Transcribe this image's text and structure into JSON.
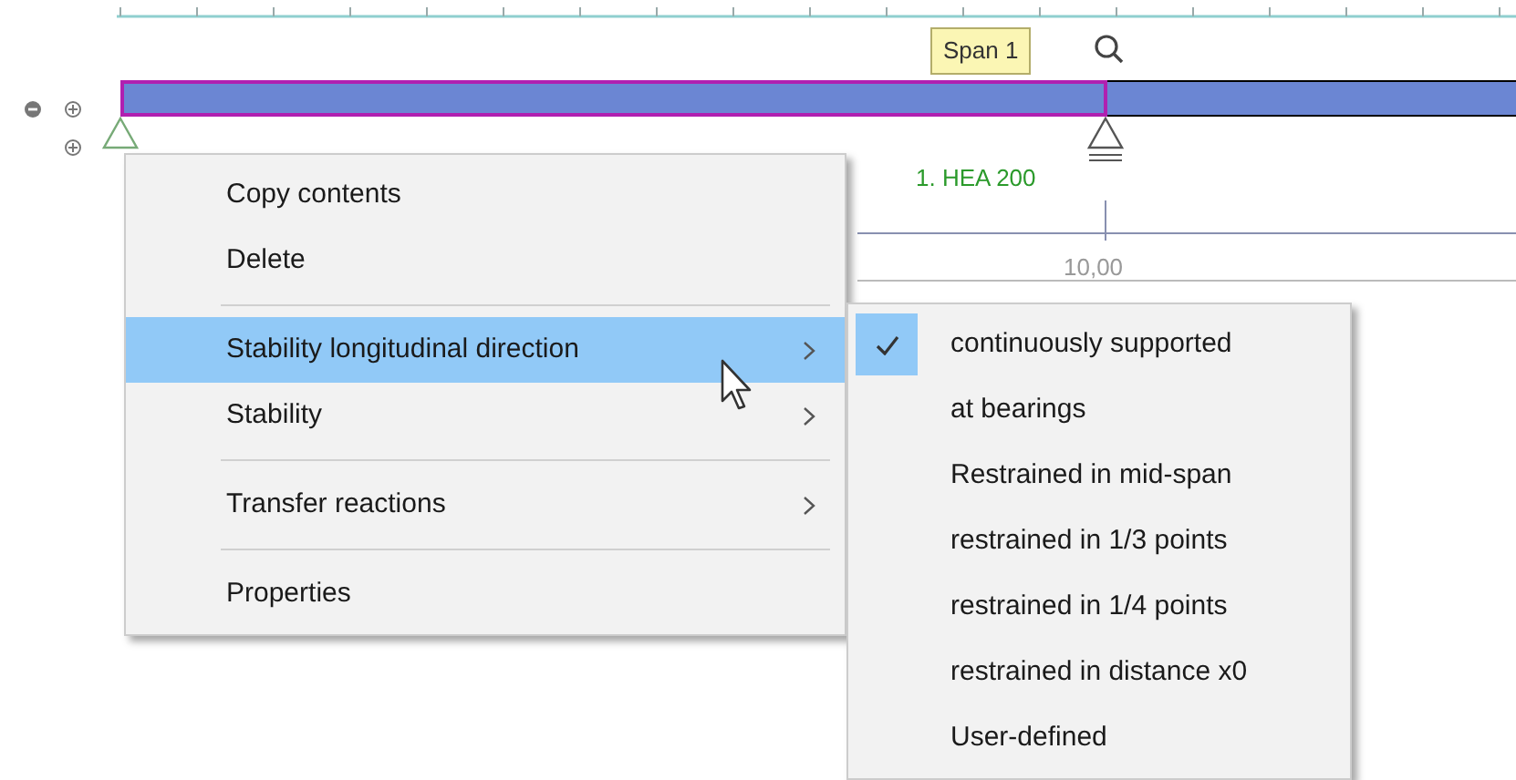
{
  "tooltip": "Span 1",
  "section_label": "1. HEA 200",
  "dimension_label": "10,00",
  "context_menu": {
    "groups": [
      [
        {
          "label": "Copy contents",
          "selected": false,
          "submenu": false
        },
        {
          "label": "Delete",
          "selected": false,
          "submenu": false
        }
      ],
      [
        {
          "label": "Stability longitudinal direction",
          "selected": true,
          "submenu": true
        },
        {
          "label": "Stability",
          "selected": false,
          "submenu": true
        }
      ],
      [
        {
          "label": "Transfer reactions",
          "selected": false,
          "submenu": true
        }
      ],
      [
        {
          "label": "Properties",
          "selected": false,
          "submenu": false
        }
      ]
    ]
  },
  "submenu": {
    "items": [
      {
        "label": "continuously supported",
        "checked": true
      },
      {
        "label": "at bearings",
        "checked": false
      },
      {
        "label": "Restrained in mid-span",
        "checked": false
      },
      {
        "label": "restrained in 1/3 points",
        "checked": false
      },
      {
        "label": "restrained in 1/4 points",
        "checked": false
      },
      {
        "label": "restrained in distance x0",
        "checked": false
      },
      {
        "label": "User-defined",
        "checked": false
      }
    ]
  }
}
